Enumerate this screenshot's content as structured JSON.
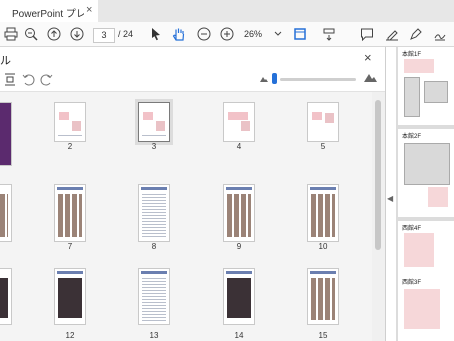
{
  "tab": {
    "title": "PowerPoint プレゼンテ...",
    "close": "×"
  },
  "toolbar": {
    "current_page": "3",
    "page_total": "/ 24",
    "zoom": "26%"
  },
  "panel": {
    "title": "ル",
    "close": "×"
  },
  "thumbnails": [
    {
      "num": "2"
    },
    {
      "num": "3"
    },
    {
      "num": "4"
    },
    {
      "num": "5"
    },
    {
      "num": "7"
    },
    {
      "num": "8"
    },
    {
      "num": "9"
    },
    {
      "num": "10"
    },
    {
      "num": "12"
    },
    {
      "num": "13"
    },
    {
      "num": "14"
    },
    {
      "num": "15"
    }
  ],
  "document": {
    "labels": [
      "本館1F",
      "本館2F",
      "西館4F",
      "西館3F"
    ]
  },
  "colors": {
    "accent": "#2570d8",
    "selected_border": "#7a7a7a"
  }
}
